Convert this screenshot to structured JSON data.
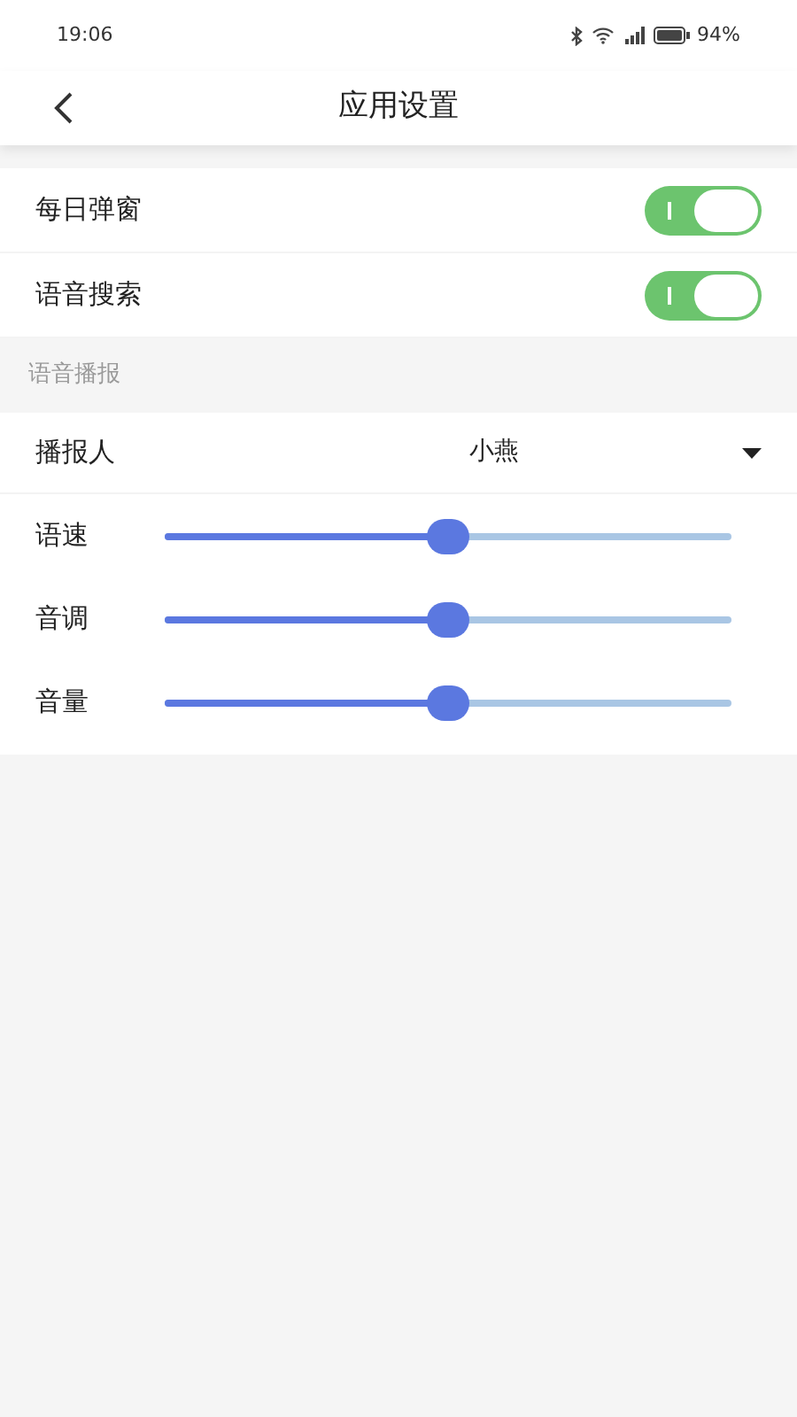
{
  "status_bar": {
    "time": "19:06",
    "battery": "94%"
  },
  "header": {
    "title": "应用设置"
  },
  "toggles": [
    {
      "label": "每日弹窗",
      "on": true
    },
    {
      "label": "语音搜索",
      "on": true
    }
  ],
  "section": {
    "title": "语音播报"
  },
  "speaker": {
    "label": "播报人",
    "value": "小燕"
  },
  "sliders": [
    {
      "label": "语速",
      "level": 0.5
    },
    {
      "label": "音调",
      "level": 0.5
    },
    {
      "label": "音量",
      "level": 0.5
    }
  ]
}
